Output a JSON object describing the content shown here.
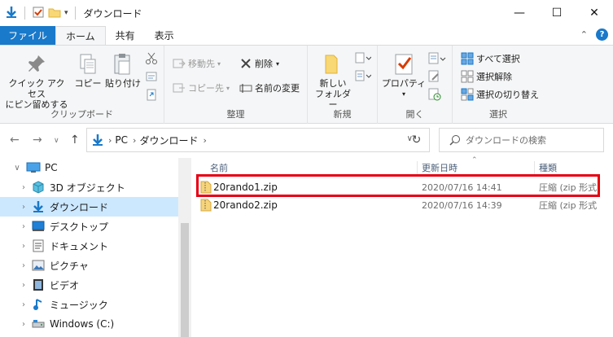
{
  "window": {
    "title": "ダウンロード",
    "controls": {
      "minimize": "—",
      "maximize": "☐",
      "close": "✕"
    }
  },
  "tabs": [
    {
      "label": "ファイル"
    },
    {
      "label": "ホーム"
    },
    {
      "label": "共有"
    },
    {
      "label": "表示"
    }
  ],
  "ribbon": {
    "clipboard": {
      "label": "クリップボード",
      "pin_line1": "クイック アクセス",
      "pin_line2": "にピン留めする",
      "copy": "コピー",
      "paste": "貼り付け"
    },
    "organize": {
      "label": "整理",
      "move_to": "移動先",
      "copy_to": "コピー先",
      "delete": "削除",
      "rename": "名前の変更"
    },
    "new": {
      "label": "新規",
      "new_folder_line1": "新しい",
      "new_folder_line2": "フォルダー"
    },
    "open": {
      "label": "開く",
      "properties": "プロパティ"
    },
    "select": {
      "label": "選択",
      "select_all": "すべて選択",
      "select_none": "選択解除",
      "invert": "選択の切り替え"
    }
  },
  "address": {
    "crumbs": [
      "PC",
      "ダウンロード"
    ]
  },
  "search": {
    "placeholder": "ダウンロードの検索"
  },
  "nav": {
    "items": [
      {
        "label": "PC"
      },
      {
        "label": "3D オブジェクト"
      },
      {
        "label": "ダウンロード"
      },
      {
        "label": "デスクトップ"
      },
      {
        "label": "ドキュメント"
      },
      {
        "label": "ピクチャ"
      },
      {
        "label": "ビデオ"
      },
      {
        "label": "ミュージック"
      },
      {
        "label": "Windows (C:)"
      }
    ]
  },
  "columns": {
    "name": "名前",
    "date": "更新日時",
    "type": "種類"
  },
  "files": [
    {
      "name": "20rando1.zip",
      "date": "2020/07/16 14:41",
      "type": "圧縮 (zip 形式"
    },
    {
      "name": "20rando2.zip",
      "date": "2020/07/16 14:39",
      "type": "圧縮 (zip 形式"
    }
  ],
  "colors": {
    "accent": "#1979ca",
    "selection": "#cce8ff",
    "highlight_border": "#e60012"
  }
}
